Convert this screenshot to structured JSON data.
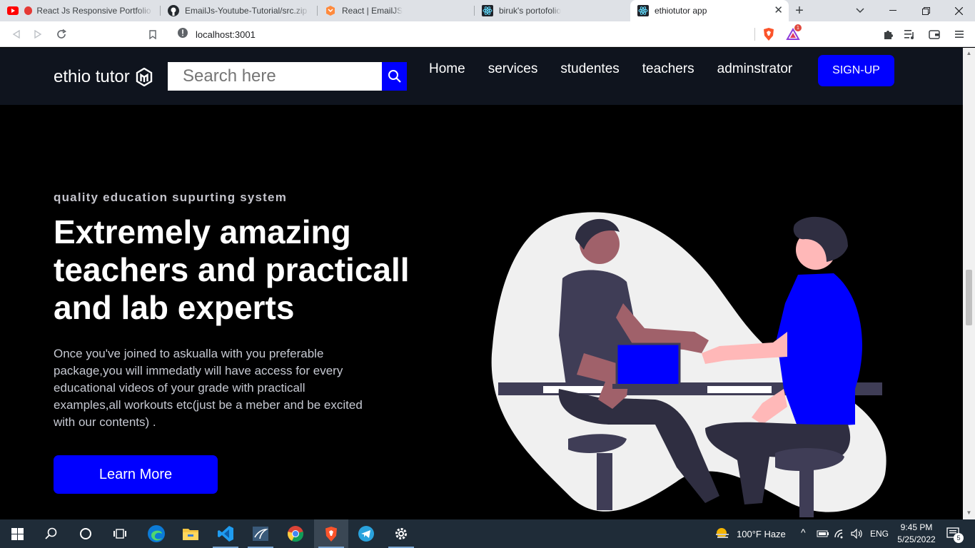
{
  "browser": {
    "tabs": [
      {
        "title": "React Js Responsive Portfolio w",
        "favicon": "youtube-icon",
        "active": false
      },
      {
        "title": "EmailJs-Youtube-Tutorial/src.zip at",
        "favicon": "github-icon",
        "active": false
      },
      {
        "title": "React | EmailJS",
        "favicon": "emailjs-icon",
        "active": false
      },
      {
        "title": "biruk's portofolio",
        "favicon": "react-icon",
        "active": false
      },
      {
        "title": "ethiotutor app",
        "favicon": "react-icon",
        "active": true
      }
    ],
    "url": "localhost:3001",
    "rewards_badge": "1"
  },
  "navbar": {
    "logo_text": "ethio tutor",
    "search_placeholder": "Search here",
    "links": [
      "Home",
      "services",
      "studentes",
      "teachers",
      "adminstrator"
    ],
    "signup_label": "SIGN-UP"
  },
  "hero": {
    "eyebrow": "quality education supurting system",
    "headline": "Extremely amazing teachers and practicall and lab experts",
    "description": "Once you've joined to askualla with you preferable package,you will immedatly will have access for every educational videos of your grade with practicall examples,all workouts etc(just be a meber and be excited with our contents) .",
    "cta_label": "Learn More"
  },
  "taskbar": {
    "weather": "100°F  Haze",
    "language": "ENG",
    "time": "9:45 PM",
    "date": "5/25/2022",
    "notification_count": "5"
  },
  "colors": {
    "accent": "#0000ff",
    "navbar_bg": "#0f141e",
    "page_bg": "#000000"
  }
}
